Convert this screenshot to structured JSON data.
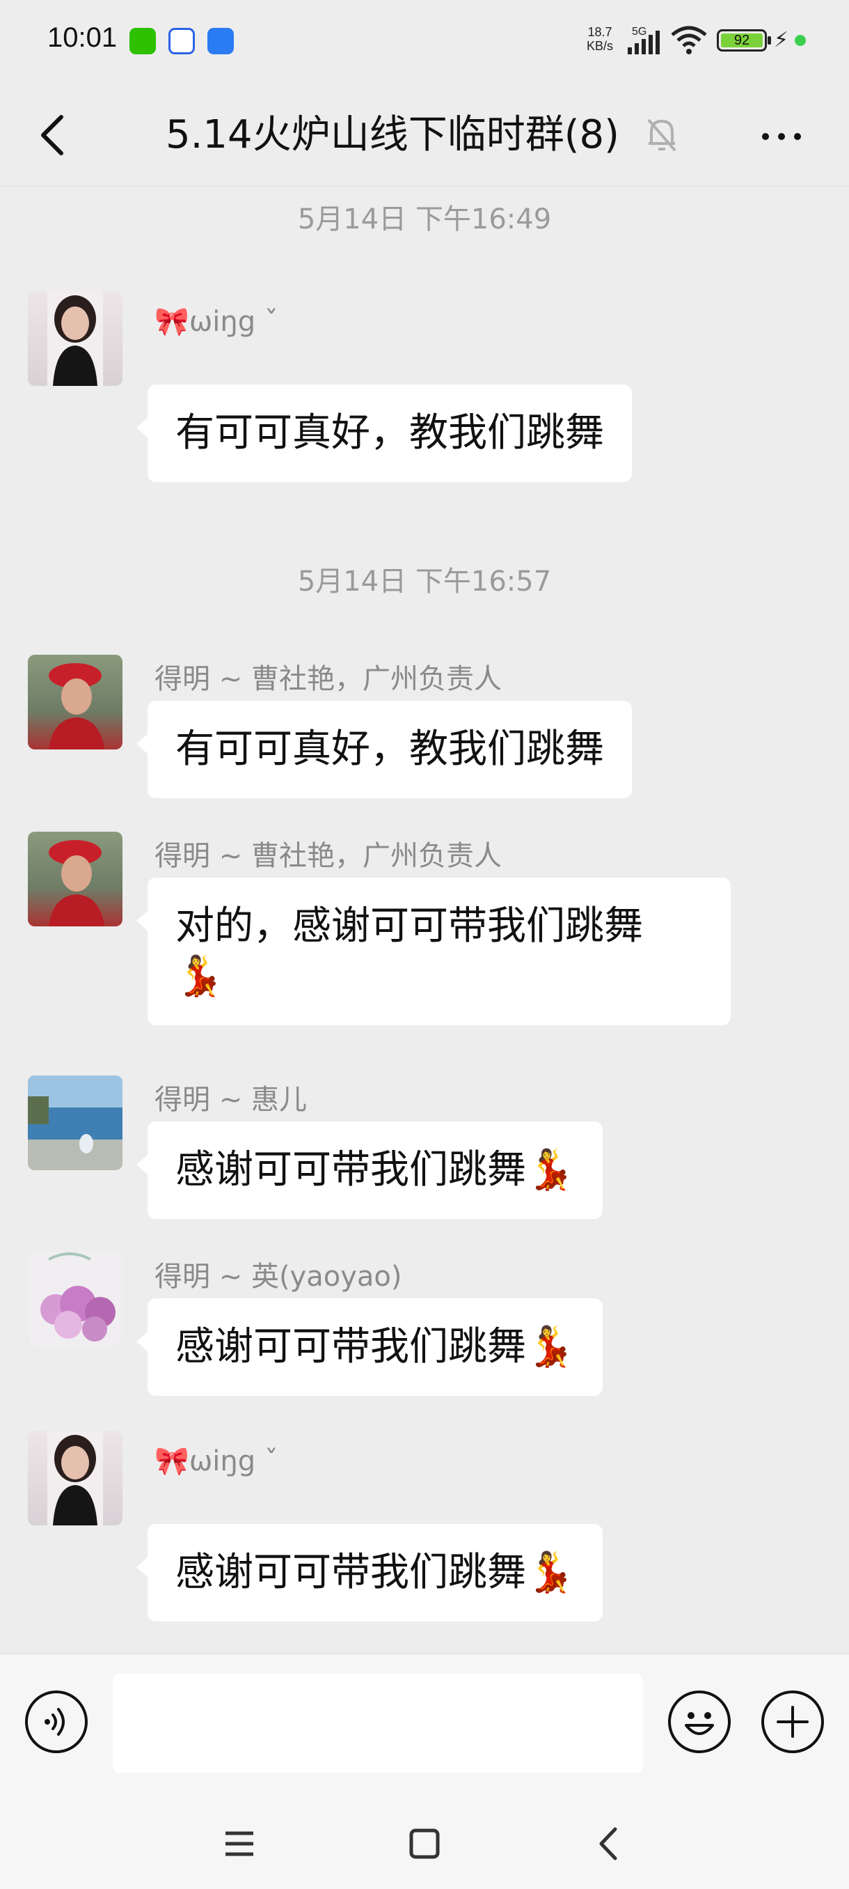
{
  "status_bar": {
    "time": "10:01",
    "net_speed_value": "18.7",
    "net_speed_unit": "KB/s",
    "network_type": "5G",
    "battery_level": "92",
    "app_icons": [
      "wechat-icon",
      "baidu-icon",
      "app-icon"
    ]
  },
  "header": {
    "title": "5.14火炉山线下临时群(8)",
    "icons": [
      "back-icon",
      "mute-bell-icon",
      "more-icon"
    ]
  },
  "messages": [
    {
      "type": "timestamp",
      "text": "5月14日 下午16:49"
    },
    {
      "type": "message",
      "sender_emoji": "🎀",
      "sender": "ωiŋg",
      "sender_suffix": "ˇ",
      "avatar": "woman-black-top-avatar",
      "text": "有可可真好，教我们跳舞"
    },
    {
      "type": "timestamp",
      "text": "5月14日 下午16:57"
    },
    {
      "type": "message",
      "sender": "得明 ~ 曹社艳，广州负责人",
      "avatar": "woman-red-cap-avatar",
      "text": "有可可真好，教我们跳舞"
    },
    {
      "type": "message",
      "sender": "得明 ~ 曹社艳，广州负责人",
      "avatar": "woman-red-cap-avatar",
      "text": "对的，感谢可可带我们跳舞",
      "emoji": "💃"
    },
    {
      "type": "message",
      "sender": "得明 ~ 惠儿",
      "avatar": "lake-photo-avatar",
      "text": "感谢可可带我们跳舞",
      "emoji": "💃"
    },
    {
      "type": "message",
      "sender": "得明 ~ 英(yaoyao)",
      "avatar": "flowers-avatar",
      "text": "感谢可可带我们跳舞",
      "emoji": "💃"
    },
    {
      "type": "message",
      "sender_emoji": "🎀",
      "sender": "ωiŋg",
      "sender_suffix": "ˇ",
      "avatar": "woman-black-top-avatar",
      "text": "感谢可可带我们跳舞",
      "emoji": "💃"
    }
  ],
  "input_bar": {
    "input_value": "",
    "icons": [
      "voice-icon",
      "emoji-icon",
      "plus-icon"
    ]
  },
  "nav_bar": {
    "icons": [
      "menu-icon",
      "home-icon",
      "back-nav-icon"
    ]
  },
  "colors": {
    "background": "#ededed",
    "bubble": "#ffffff",
    "battery": "#7bd13a"
  }
}
